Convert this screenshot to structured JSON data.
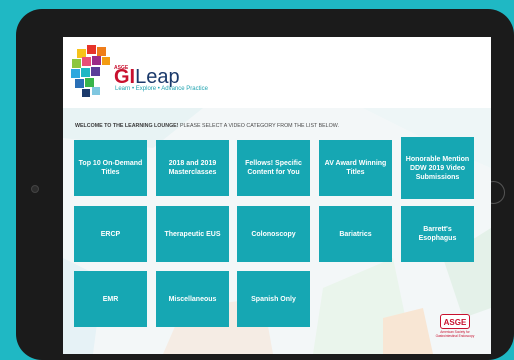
{
  "header": {
    "asge_small": "ASGE",
    "brand_gi": "GI",
    "brand_leap": "Leap",
    "tagline": "Learn • Explore • Advance Practice"
  },
  "welcome": {
    "bold_text": "WELCOME TO THE LEARNING LOUNGE!",
    "rest_text": " PLEASE SELECT A VIDEO CATEGORY FROM THE LIST BELOW."
  },
  "tiles": [
    "Top 10 On-Demand Titles",
    "2018 and 2019 Masterclasses",
    "Fellows! Specific Content for You",
    "AV Award Winning Titles",
    "Honorable Mention DDW 2019 Video Submissions",
    "ERCP",
    "Therapeutic EUS",
    "Colonoscopy",
    "Bariatrics",
    "Barrett's Esophagus",
    "EMR",
    "Miscellaneous",
    "Spanish Only"
  ],
  "footer_badge": {
    "label": "ASGE",
    "caption": "American Society for Gastrointestinal Endoscopy"
  },
  "colors": {
    "background": "#1fb8c4",
    "tile": "#16a7b3",
    "asge_red": "#c8102e",
    "navy": "#1b3a6b"
  }
}
